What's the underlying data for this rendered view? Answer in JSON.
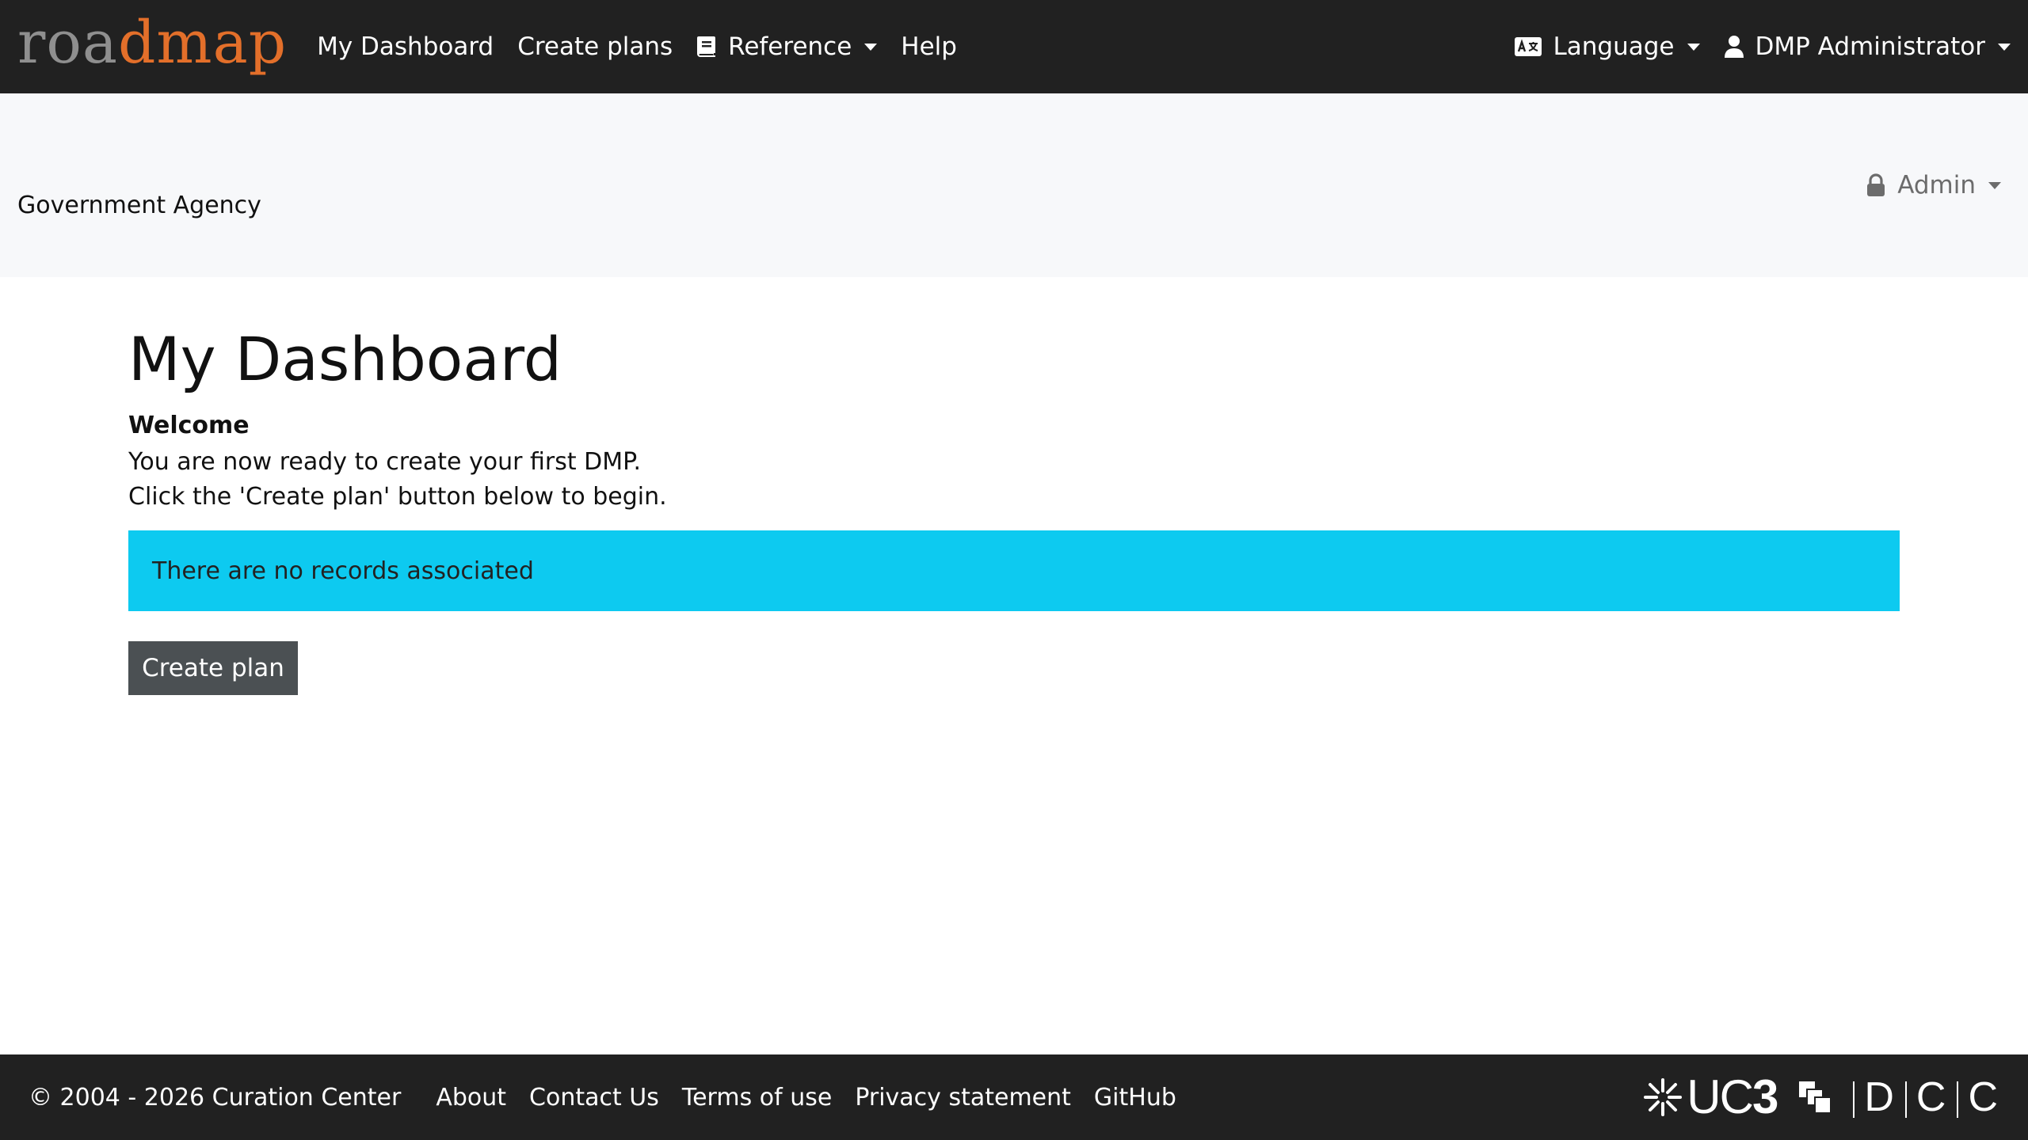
{
  "brand": {
    "logo_part1": "roa",
    "logo_part2": "dmap",
    "accent_color": "#e36f2a"
  },
  "topnav": {
    "links": [
      {
        "label": "My Dashboard"
      },
      {
        "label": "Create plans"
      },
      {
        "label": "Reference",
        "icon": "book-icon",
        "dropdown": true
      },
      {
        "label": "Help"
      }
    ],
    "language": {
      "label": "Language",
      "icon": "language-icon"
    },
    "user": {
      "label": "DMP Administrator",
      "icon": "user-icon"
    }
  },
  "subheader": {
    "org_name": "Government Agency",
    "admin": {
      "label": "Admin",
      "icon": "lock-icon"
    }
  },
  "main": {
    "title": "My Dashboard",
    "welcome_title": "Welcome",
    "welcome_lines": [
      "You are now ready to create your first DMP.",
      "Click the 'Create plan' button below to begin."
    ],
    "info_message": "There are no records associated",
    "create_button": "Create plan"
  },
  "footer": {
    "copyright": "© 2004 - 2026 Curation Center",
    "links": [
      "About",
      "Contact Us",
      "Terms of use",
      "Privacy statement",
      "GitHub"
    ],
    "logos": {
      "uc3_a": "UC",
      "uc3_b": "3",
      "dcc": [
        "D",
        "C",
        "C"
      ]
    }
  },
  "colors": {
    "navbar": "#212121",
    "subheader": "#f7f8fa",
    "info": "#0dcaf0",
    "button": "#4b5053"
  }
}
